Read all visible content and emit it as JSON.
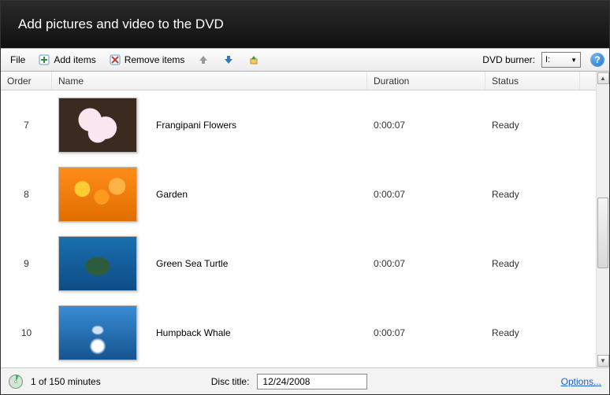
{
  "title": "Add pictures and video to the DVD",
  "toolbar": {
    "file": "File",
    "add_items": "Add items",
    "remove_items": "Remove items"
  },
  "dvd_burner_label": "DVD burner:",
  "dvd_burner_value": "I:",
  "columns": {
    "order": "Order",
    "name": "Name",
    "duration": "Duration",
    "status": "Status"
  },
  "rows": [
    {
      "order": "7",
      "name": "Frangipani Flowers",
      "duration": "0:00:07",
      "status": "Ready",
      "thumb": "thumb-frangipani"
    },
    {
      "order": "8",
      "name": "Garden",
      "duration": "0:00:07",
      "status": "Ready",
      "thumb": "thumb-garden"
    },
    {
      "order": "9",
      "name": "Green Sea Turtle",
      "duration": "0:00:07",
      "status": "Ready",
      "thumb": "thumb-turtle"
    },
    {
      "order": "10",
      "name": "Humpback Whale",
      "duration": "0:00:07",
      "status": "Ready",
      "thumb": "thumb-whale"
    }
  ],
  "status": {
    "minutes": "1 of 150 minutes",
    "disc_title_label": "Disc title:",
    "disc_title_value": "12/24/2008",
    "options": "Options..."
  }
}
